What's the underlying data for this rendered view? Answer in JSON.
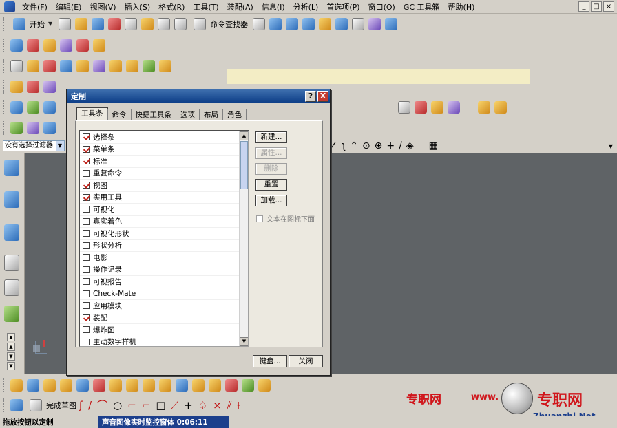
{
  "menubar": {
    "items": [
      "文件(F)",
      "编辑(E)",
      "视图(V)",
      "插入(S)",
      "格式(R)",
      "工具(T)",
      "装配(A)",
      "信息(I)",
      "分析(L)",
      "首选项(P)",
      "窗口(O)",
      "GC 工具箱",
      "帮助(H)"
    ]
  },
  "toolbar": {
    "start_label": "开始",
    "command_finder_label": "命令查找器"
  },
  "filter": {
    "value": "没有选择过滤器"
  },
  "dialog": {
    "title": "定制",
    "help_button": "?",
    "close_button": "X",
    "tabs": [
      "工具条",
      "命令",
      "快捷工具条",
      "选项",
      "布局",
      "角色"
    ],
    "active_tab": "工具条",
    "toolbar_list": [
      {
        "label": "选择条",
        "checked": true
      },
      {
        "label": "菜单条",
        "checked": true
      },
      {
        "label": "标准",
        "checked": true
      },
      {
        "label": "重复命令",
        "checked": false
      },
      {
        "label": "视图",
        "checked": true
      },
      {
        "label": "实用工具",
        "checked": true
      },
      {
        "label": "可视化",
        "checked": false
      },
      {
        "label": "真实着色",
        "checked": false
      },
      {
        "label": "可视化形状",
        "checked": false
      },
      {
        "label": "形状分析",
        "checked": false
      },
      {
        "label": "电影",
        "checked": false
      },
      {
        "label": "操作记录",
        "checked": false
      },
      {
        "label": "可视报告",
        "checked": false
      },
      {
        "label": "Check-Mate",
        "checked": false
      },
      {
        "label": "应用模块",
        "checked": false
      },
      {
        "label": "装配",
        "checked": true
      },
      {
        "label": "爆炸图",
        "checked": false
      },
      {
        "label": "主动数字样机",
        "checked": false
      }
    ],
    "buttons": {
      "new": "新建...",
      "properties": "属性...",
      "delete": "删除",
      "reset": "重置",
      "load": "加载..."
    },
    "text_below_icon": "文本在图标下面",
    "keyboard_button": "键盘...",
    "close_label": "关闭"
  },
  "bottom_toolbar": {
    "finish_sketch_label": "完成草图"
  },
  "status": {
    "left_text": "拖放按钮以定制",
    "right_text": "声音图像实时监控窗体  0:06:11"
  },
  "watermark": {
    "site_name": "专职网",
    "url_partial": "www.",
    "brand_cn": "专职网",
    "brand_en": "Zhuanzhi.Net"
  }
}
